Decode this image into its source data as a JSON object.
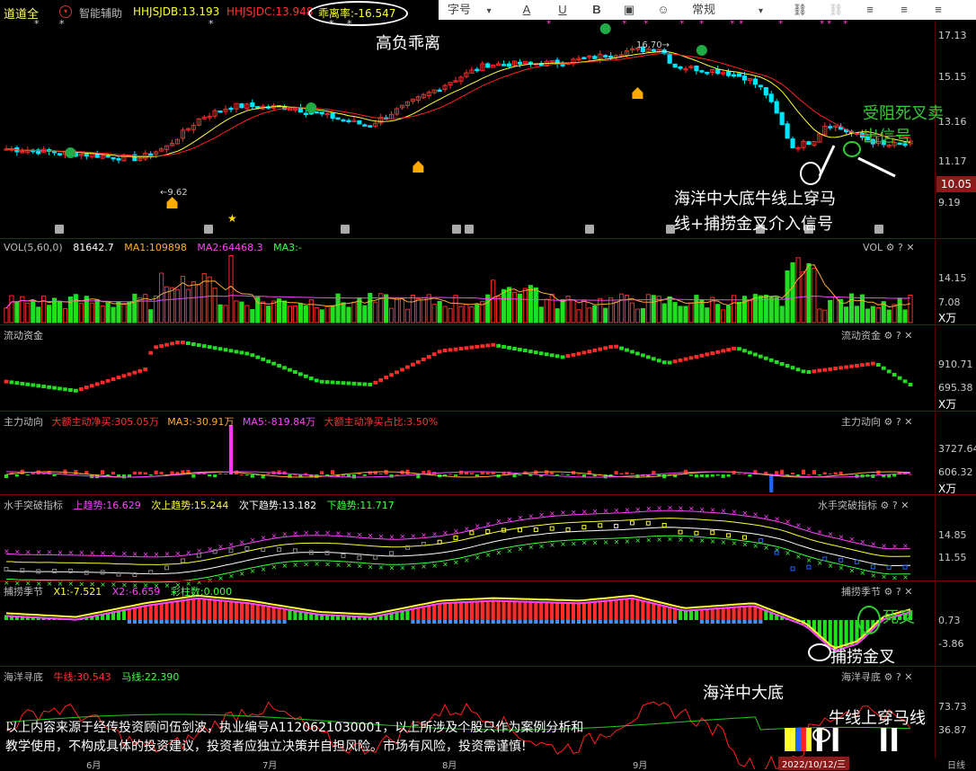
{
  "header": {
    "stock_name": "道道全",
    "assist_label": "智能辅助",
    "hhjsjdb": "HHJSJDB:13.193",
    "hhjsjdc": "HHJSJDC:13.948",
    "deviation_rate": "乖离率:-16.547"
  },
  "toolbar": {
    "font_label": "字号",
    "style_label": "常规",
    "bold": "B",
    "underline": "U",
    "font_color": "A"
  },
  "main_panel": {
    "y_ticks": [
      "17.13",
      "15.15",
      "13.16",
      "11.17",
      "9.19"
    ],
    "current_price": "10.05",
    "high_label": "16.70",
    "low_label": "9.62",
    "annotations": {
      "high_deviation": "高负乖离",
      "death_cross_line1": "受阻死叉卖",
      "death_cross_line2": "出信号",
      "bottom_signal_line1": "海洋中大底牛线上穿马",
      "bottom_signal_line2": "线+捕捞金叉介入信号"
    }
  },
  "vol_panel": {
    "title": "VOL(5,60,0)",
    "value": "81642.7",
    "ma1": "MA1:109898",
    "ma2": "MA2:64468.3",
    "ma3": "MA3:-",
    "right_label": "VOL",
    "y_ticks": [
      "14.15",
      "7.08"
    ],
    "unit": "X万"
  },
  "liquidity_panel": {
    "title": "流动资金",
    "right_label": "流动资金",
    "y_ticks": [
      "910.71",
      "695.38"
    ],
    "unit": "X万"
  },
  "main_force_panel": {
    "title": "主力动向",
    "net_buy": "大额主动净买:305.05万",
    "ma3": "MA3:-30.91万",
    "ma5": "MA5:-819.84万",
    "ratio": "大额主动净买占比:3.50%",
    "right_label": "主力动向",
    "y_ticks": [
      "3727.64",
      "606.32"
    ],
    "unit": "X万"
  },
  "sailor_panel": {
    "title": "水手突破指标",
    "up": "上趋势:16.629",
    "sub_up": "次上趋势:15.244",
    "sub_down": "次下趋势:13.182",
    "down": "下趋势:11.717",
    "right_label": "水手突破指标",
    "y_ticks": [
      "14.85",
      "11.55"
    ]
  },
  "catch_panel": {
    "title": "捕捞季节",
    "x1": "X1:-7.521",
    "x2": "X2:-6.659",
    "bars": "彩柱数:0.000",
    "right_label": "捕捞季节",
    "y_ticks": [
      "0.73",
      "-3.86"
    ],
    "annotations": {
      "death_cross": "死叉",
      "golden_cross": "捕捞金叉"
    }
  },
  "ocean_panel": {
    "title": "海洋寻底",
    "bull_line": "牛线:30.543",
    "horse_line": "马线:22.390",
    "right_label": "海洋寻底",
    "y_ticks": [
      "73.73",
      "36.87"
    ],
    "annotations": {
      "ocean_bottom": "海洋中大底",
      "bull_cross": "牛线上穿马线"
    }
  },
  "disclaimer": {
    "line1": "以上内容来源于经传投资顾问伍剑波，执业编号A1120621030001，以上所涉及个股只作为案例分析和",
    "line2": "教学使用，不构成具体的投资建议，投资者应独立决策并自担风险。市场有风险，投资需谨慎!"
  },
  "x_axis": {
    "months": [
      "6月",
      "7月",
      "8月",
      "9月"
    ],
    "cursor_date": "2022/10/12/三",
    "period": "日线"
  },
  "colors": {
    "up": "#ff2a2a",
    "down": "#00e5ff",
    "green_bar": "#22dd22",
    "yellow": "#ffff00",
    "magenta": "#ff33ff",
    "annotation_green": "#33cc33"
  }
}
